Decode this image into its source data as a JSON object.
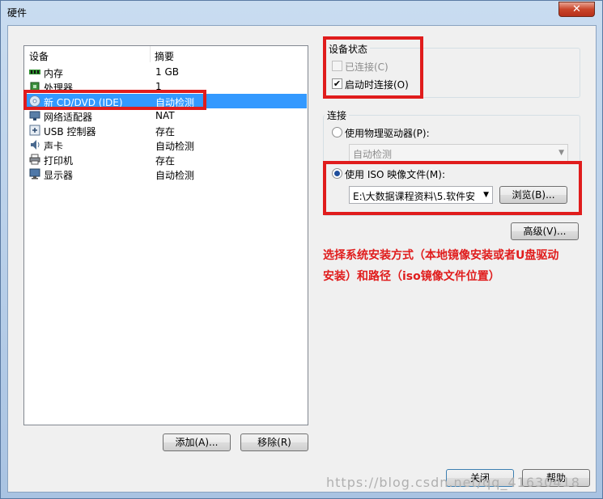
{
  "window": {
    "title": "硬件",
    "close_glyph": "✕"
  },
  "device_list": {
    "headers": {
      "device": "设备",
      "summary": "摘要"
    },
    "rows": [
      {
        "name": "内存",
        "summary": "1 GB",
        "icon": "memory-icon"
      },
      {
        "name": "处理器",
        "summary": "1",
        "icon": "processor-icon"
      },
      {
        "name": "新 CD/DVD (IDE)",
        "summary": "自动检测",
        "icon": "cd-dvd-icon",
        "selected": true
      },
      {
        "name": "网络适配器",
        "summary": "NAT",
        "icon": "network-adapter-icon"
      },
      {
        "name": "USB 控制器",
        "summary": "存在",
        "icon": "usb-icon"
      },
      {
        "name": "声卡",
        "summary": "自动检测",
        "icon": "sound-card-icon"
      },
      {
        "name": "打印机",
        "summary": "存在",
        "icon": "printer-icon"
      },
      {
        "name": "显示器",
        "summary": "自动检测",
        "icon": "display-icon"
      }
    ]
  },
  "buttons": {
    "add": "添加(A)...",
    "remove": "移除(R)",
    "browse": "浏览(B)...",
    "advanced": "高级(V)...",
    "close": "关闭",
    "help": "帮助"
  },
  "device_status": {
    "title": "设备状态",
    "connected": {
      "label": "已连接(C)",
      "checked": false,
      "enabled": false
    },
    "connect_at_power_on": {
      "label": "启动时连接(O)",
      "checked": true,
      "enabled": true
    }
  },
  "connection": {
    "title": "连接",
    "physical_drive": {
      "label": "使用物理驱动器(P):",
      "selected": false,
      "combo_value": "自动检测"
    },
    "iso_image": {
      "label": "使用 ISO 映像文件(M):",
      "selected": true,
      "path_value": "E:\\大数据课程资料\\5.软件安"
    }
  },
  "annotation": {
    "line1": "选择系统安装方式（本地镜像安装或者U盘驱动",
    "line2": "安装）和路径（iso镜像文件位置）",
    "color": "#e01c1c"
  },
  "watermark": "https://blog.csdn.net/qq_41630418",
  "colors": {
    "selection": "#3399ff",
    "highlight_box": "#e01c1c"
  }
}
